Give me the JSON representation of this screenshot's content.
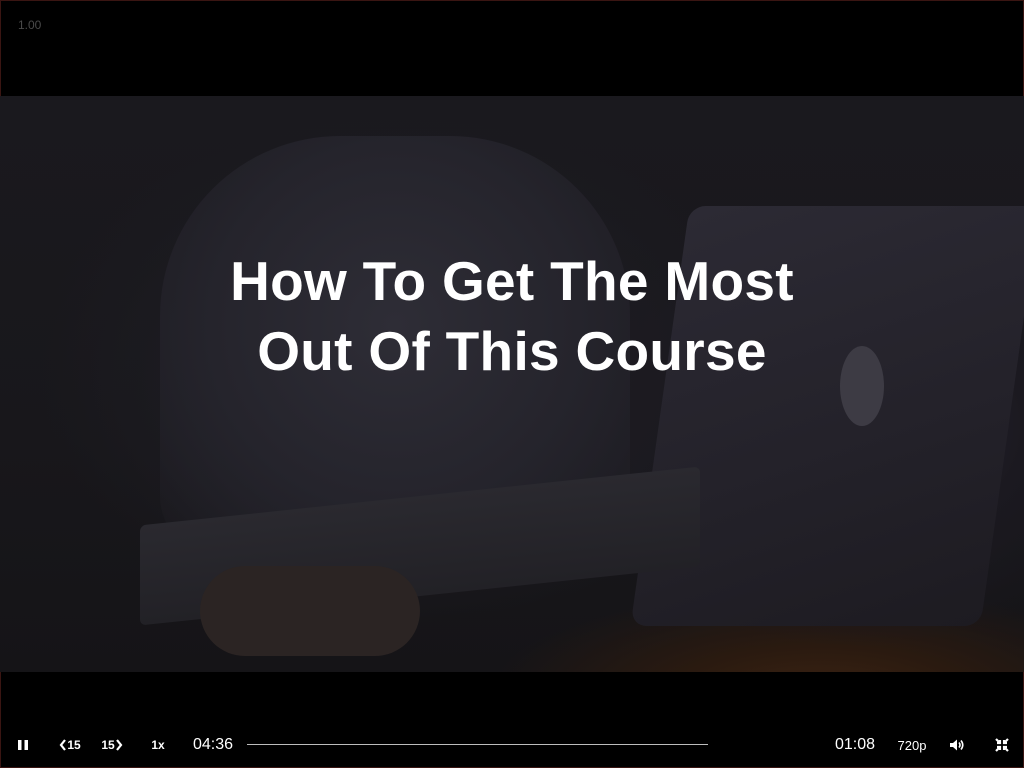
{
  "player": {
    "top_readout": "1.00",
    "title_lines": [
      "How To Get The Most",
      "Out Of This Course"
    ],
    "colors": {
      "background": "#000000",
      "title": "#ffffff",
      "progress_track": "#bdbdbd"
    }
  },
  "controls": {
    "pause_icon": "pause-icon",
    "skip_back_label": "15",
    "skip_forward_label": "15",
    "playback_rate": "1x",
    "current_time": "04:36",
    "remaining_time": "01:08",
    "quality": "720p",
    "volume_icon": "volume-icon",
    "exit_fullscreen_icon": "exit-fullscreen-icon",
    "progress_fraction": 0.0
  }
}
